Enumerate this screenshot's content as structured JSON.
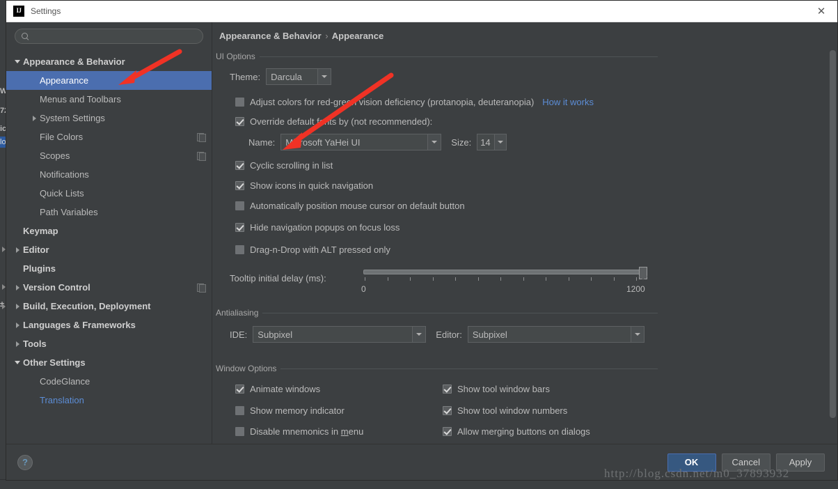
{
  "window": {
    "title": "Settings",
    "app_icon": "intellij-idea-icon",
    "close_label": "✕"
  },
  "sidebar": {
    "search": {
      "value": "",
      "placeholder": ""
    },
    "items": [
      {
        "label": "Appearance & Behavior",
        "level": 0,
        "twisty": "down",
        "bold": true,
        "selected": false,
        "badge": false,
        "link": false
      },
      {
        "label": "Appearance",
        "level": 1,
        "twisty": "none",
        "bold": false,
        "selected": true,
        "badge": false,
        "link": false
      },
      {
        "label": "Menus and Toolbars",
        "level": 1,
        "twisty": "none",
        "bold": false,
        "selected": false,
        "badge": false,
        "link": false
      },
      {
        "label": "System Settings",
        "level": 1,
        "twisty": "right",
        "bold": false,
        "selected": false,
        "badge": false,
        "link": false
      },
      {
        "label": "File Colors",
        "level": 1,
        "twisty": "none",
        "bold": false,
        "selected": false,
        "badge": true,
        "link": false
      },
      {
        "label": "Scopes",
        "level": 1,
        "twisty": "none",
        "bold": false,
        "selected": false,
        "badge": true,
        "link": false
      },
      {
        "label": "Notifications",
        "level": 1,
        "twisty": "none",
        "bold": false,
        "selected": false,
        "badge": false,
        "link": false
      },
      {
        "label": "Quick Lists",
        "level": 1,
        "twisty": "none",
        "bold": false,
        "selected": false,
        "badge": false,
        "link": false
      },
      {
        "label": "Path Variables",
        "level": 1,
        "twisty": "none",
        "bold": false,
        "selected": false,
        "badge": false,
        "link": false
      },
      {
        "label": "Keymap",
        "level": 0,
        "twisty": "none",
        "bold": true,
        "selected": false,
        "badge": false,
        "link": false
      },
      {
        "label": "Editor",
        "level": 0,
        "twisty": "right",
        "bold": true,
        "selected": false,
        "badge": false,
        "link": false
      },
      {
        "label": "Plugins",
        "level": 0,
        "twisty": "none",
        "bold": true,
        "selected": false,
        "badge": false,
        "link": false
      },
      {
        "label": "Version Control",
        "level": 0,
        "twisty": "right",
        "bold": true,
        "selected": false,
        "badge": true,
        "link": false
      },
      {
        "label": "Build, Execution, Deployment",
        "level": 0,
        "twisty": "right",
        "bold": true,
        "selected": false,
        "badge": false,
        "link": false
      },
      {
        "label": "Languages & Frameworks",
        "level": 0,
        "twisty": "right",
        "bold": true,
        "selected": false,
        "badge": false,
        "link": false
      },
      {
        "label": "Tools",
        "level": 0,
        "twisty": "right",
        "bold": true,
        "selected": false,
        "badge": false,
        "link": false
      },
      {
        "label": "Other Settings",
        "level": 0,
        "twisty": "down",
        "bold": true,
        "selected": false,
        "badge": false,
        "link": false
      },
      {
        "label": "CodeGlance",
        "level": 1,
        "twisty": "none",
        "bold": false,
        "selected": false,
        "badge": false,
        "link": false
      },
      {
        "label": "Translation",
        "level": 1,
        "twisty": "none",
        "bold": false,
        "selected": false,
        "badge": false,
        "link": true
      }
    ]
  },
  "main": {
    "breadcrumb_parent": "Appearance & Behavior",
    "breadcrumb_sep": "›",
    "breadcrumb_current": "Appearance",
    "ui_options": {
      "group_title": "UI Options",
      "theme_label": "Theme:",
      "theme_value": "Darcula",
      "adjust_colors_label": "Adjust colors for red-green vision deficiency (protanopia, deuteranopia)",
      "adjust_colors_checked": false,
      "how_it_works_link": "How it works",
      "override_fonts_label": "Override default fonts by (not recommended):",
      "override_fonts_checked": true,
      "name_label": "Name:",
      "name_value": "Microsoft YaHei UI",
      "size_label": "Size:",
      "size_value": "14",
      "cyclic_scrolling_label": "Cyclic scrolling in list",
      "cyclic_scrolling_checked": true,
      "show_icons_label": "Show icons in quick navigation",
      "show_icons_checked": true,
      "auto_position_label": "Automatically position mouse cursor on default button",
      "auto_position_checked": false,
      "hide_popups_label": "Hide navigation popups on focus loss",
      "hide_popups_checked": true,
      "drag_alt_label": "Drag-n-Drop with ALT pressed only",
      "drag_alt_checked": false,
      "tooltip_label": "Tooltip initial delay (ms):",
      "tooltip_min": "0",
      "tooltip_max": "1200",
      "tooltip_value": 1200,
      "tooltip_tick_count": 13
    },
    "antialiasing": {
      "group_title": "Antialiasing",
      "ide_label": "IDE:",
      "ide_value": "Subpixel",
      "editor_label": "Editor:",
      "editor_value": "Subpixel"
    },
    "window_options": {
      "group_title": "Window Options",
      "animate_windows_label": "Animate windows",
      "animate_windows_checked": true,
      "show_memory_label": "Show memory indicator",
      "show_memory_checked": false,
      "disable_mnemonics_label_pre": "Disable mnemonics in ",
      "disable_mnemonics_label_mnemonic": "m",
      "disable_mnemonics_label_post": "enu",
      "disable_mnemonics_checked": false,
      "show_tool_bars_label": "Show tool window bars",
      "show_tool_bars_checked": true,
      "show_tool_numbers_label": "Show tool window numbers",
      "show_tool_numbers_checked": true,
      "allow_merging_label": "Allow merging buttons on dialogs",
      "allow_merging_checked": true
    }
  },
  "footer": {
    "help_label": "?",
    "ok_label": "OK",
    "cancel_label": "Cancel",
    "apply_label": "Apply"
  },
  "watermark": "http://blog.csdn.net/m0_37893932",
  "background": {
    "left_fragments": [
      "W",
      "72",
      "ic",
      "±",
      "lo"
    ],
    "bottom_text": "",
    "colors": {
      "accent_blue": "#4b6eaf",
      "link_blue": "#5c8dd6",
      "panel_bg": "#3c3f41",
      "annotation_red": "#f03225"
    }
  }
}
